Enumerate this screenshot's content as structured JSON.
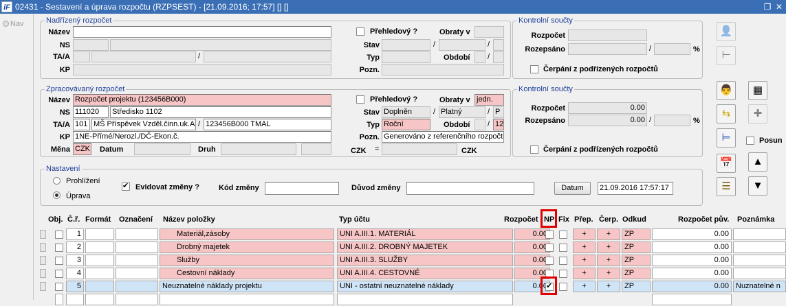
{
  "window": {
    "title": "02431 - Sestavení a úprava rozpočtu (RZPSEST) - [21.09.2016; 17:57] [] []",
    "logo": "iF",
    "restore_icon": "restore-icon",
    "close_icon": "close-icon"
  },
  "nav": {
    "label": "Nav"
  },
  "parent": {
    "legend": "Nadřízený rozpočet",
    "labels": {
      "nazev": "Název",
      "ns": "NS",
      "taa": "TA/A",
      "kp": "KP",
      "prehledovy": "Přehledový ?",
      "obraty": "Obraty v",
      "stav": "Stav",
      "typ": "Typ",
      "obdobi": "Období",
      "pozn": "Pozn."
    },
    "slash": "/"
  },
  "parent_sums": {
    "legend": "Kontrolní součty",
    "rozpocet": "Rozpočet",
    "rozepsano": "Rozepsáno",
    "pct": "%",
    "slash": "/",
    "cerpani": "Čerpání z podřízených rozpočtů"
  },
  "proc": {
    "legend": "Zpracovávaný rozpočet",
    "labels": {
      "nazev": "Název",
      "ns": "NS",
      "taa": "TA/A",
      "kp": "KP",
      "mena": "Měna",
      "datum": "Datum",
      "druh": "Druh",
      "prehledovy": "Přehledový ?",
      "obraty": "Obraty v",
      "stav": "Stav",
      "typ": "Typ",
      "obdobi": "Období",
      "pozn": "Pozn.",
      "czk_l": "CZK",
      "eq": "=",
      "czk_r": "CZK"
    },
    "values": {
      "nazev": "Rozpočet projektu (123456B000)",
      "ns_code": "111020",
      "ns_name": "Středisko 1102",
      "ta": "101",
      "ta_name": "MŠ Příspěvek Vzděl.činn.uk.A,",
      "ta_code": "123456B000 TMAL",
      "kp": "1NE-Přímé/Nerozl./DČ-Ekon.č.",
      "mena": "CZK",
      "obraty": "jedn.",
      "stav1": "Doplněn",
      "stav2": "Platný",
      "stav3": "P",
      "typ": "Roční",
      "obdobi": "12",
      "pozn": "Generováno z referenčního rozpočtu"
    },
    "slash": "/"
  },
  "proc_sums": {
    "legend": "Kontrolní součty",
    "rozpocet": "Rozpočet",
    "rozepsano": "Rozepsáno",
    "rozpocet_val": "0.00",
    "rozepsano_val": "0.00",
    "pct": "%",
    "slash": "/",
    "cerpani": "Čerpání z podřízených rozpočtů"
  },
  "settings": {
    "legend": "Nastavení",
    "prohlizeni": "Prohlížení",
    "uprava": "Úprava",
    "evidovat": "Evidovat změny ?",
    "kod_zmeny": "Kód změny",
    "duvod_zmeny": "Důvod změny",
    "datum_btn": "Datum",
    "datum_val": "21.09.2016 17:57:17"
  },
  "toolbar": {
    "posun": "Posun",
    "icons": [
      "person-icon",
      "tree-icon",
      "user-icon",
      "calculator-icon",
      "swap-icon",
      "add-icon",
      "hierarchy-icon",
      "calendar-icon",
      "edit-list-icon",
      "arrow-up-icon",
      "arrow-down-icon"
    ]
  },
  "table": {
    "headers": {
      "obj": "Obj.",
      "cr": "Č.ř.",
      "format": "Formát",
      "oznaceni": "Označení",
      "nazev": "Název položky",
      "typ_uctu": "Typ účtu",
      "rozpocet": "Rozpočet",
      "np": "NP",
      "fix": "Fix",
      "prep": "Přep.",
      "cerp": "Čerp.",
      "odkud": "Odkud",
      "rozpocet_puv": "Rozpočet pův.",
      "poznamka": "Poznámka"
    },
    "rows": [
      {
        "cr": "1",
        "nazev": "Materiál,zásoby",
        "typ": "UNI A.III.1. MATERIÁL",
        "rozpocet": "0.00",
        "np": false,
        "prep": "+",
        "cerp": "+",
        "odkud": "ZP",
        "puv": "0.00",
        "pozn": ""
      },
      {
        "cr": "2",
        "nazev": "Drobný majetek",
        "typ": "UNI A.III.2. DROBNÝ MAJETEK",
        "rozpocet": "0.00",
        "np": false,
        "prep": "+",
        "cerp": "+",
        "odkud": "ZP",
        "puv": "0.00",
        "pozn": ""
      },
      {
        "cr": "3",
        "nazev": "Služby",
        "typ": "UNI A.III.3. SLUŽBY",
        "rozpocet": "0.00",
        "np": false,
        "prep": "+",
        "cerp": "+",
        "odkud": "ZP",
        "puv": "0.00",
        "pozn": ""
      },
      {
        "cr": "4",
        "nazev": "Cestovní náklady",
        "typ": "UNI A.III.4. CESTOVNÉ",
        "rozpocet": "0.00",
        "np": false,
        "prep": "+",
        "cerp": "+",
        "odkud": "ZP",
        "puv": "0.00",
        "pozn": ""
      },
      {
        "cr": "5",
        "nazev": "Neuznatelné náklady projektu",
        "typ": "UNI - ostatní neuznatelné náklady",
        "rozpocet": "0.00",
        "np": true,
        "prep": "+",
        "cerp": "+",
        "odkud": "ZP",
        "puv": "0.00",
        "pozn": "Nuznatelné n"
      }
    ]
  }
}
